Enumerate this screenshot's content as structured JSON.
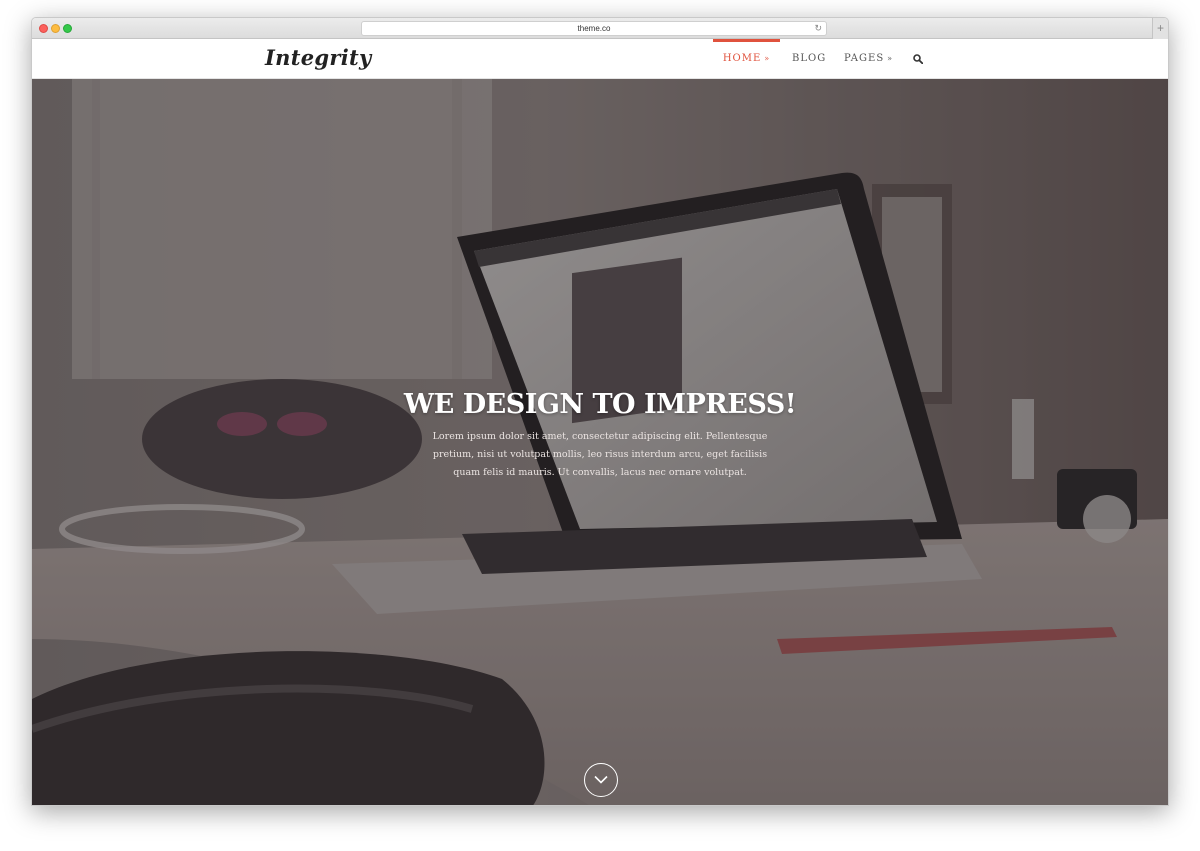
{
  "browser": {
    "url": "theme.co",
    "reload_icon": "reload-icon",
    "new_tab_label": "+"
  },
  "header": {
    "logo": "Integrity",
    "nav": [
      {
        "label": "HOME",
        "active": true,
        "has_dropdown": true
      },
      {
        "label": "BLOG",
        "active": false,
        "has_dropdown": false
      },
      {
        "label": "PAGES",
        "active": false,
        "has_dropdown": true
      }
    ],
    "search_icon": "search-icon",
    "accent_color": "#e0523d"
  },
  "hero": {
    "title": "WE DESIGN TO IMPRESS!",
    "text": "Lorem ipsum dolor sit amet, consectetur adipiscing elit. Pellentesque pretium, nisi ut volutpat mollis, leo risus interdum arcu, eget facilisis quam felis id mauris. Ut convallis, lacus nec ornare volutpat.",
    "scroll_icon": "chevron-down-icon"
  }
}
